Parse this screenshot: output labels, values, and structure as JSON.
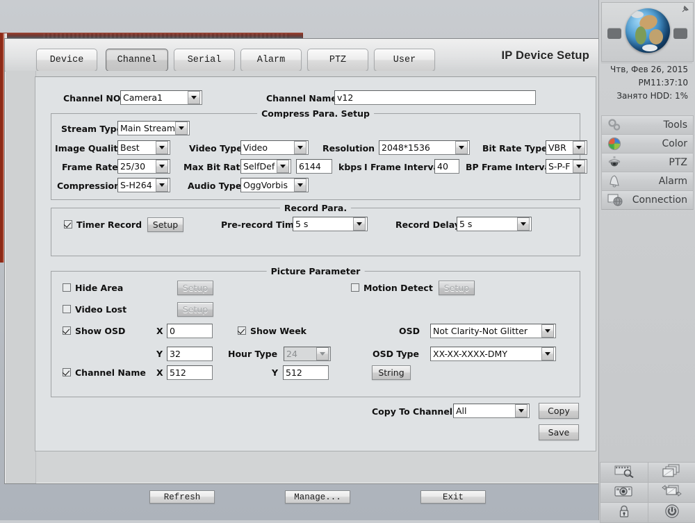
{
  "window": {
    "title": "IP Device Setup"
  },
  "tabs": [
    {
      "label": "Device",
      "active": false
    },
    {
      "label": "Channel",
      "active": true
    },
    {
      "label": "Serial",
      "active": false
    },
    {
      "label": "Alarm",
      "active": false
    },
    {
      "label": "PTZ",
      "active": false
    },
    {
      "label": "User",
      "active": false
    }
  ],
  "top_row": {
    "channel_no_label": "Channel NO",
    "channel_no_value": "Camera1",
    "channel_name_label": "Channel Name",
    "channel_name_value": "v12"
  },
  "compress": {
    "title": "Compress Para. Setup",
    "stream_type_label": "Stream Type",
    "stream_type_value": "Main Stream",
    "image_quality_label": "Image Quality",
    "image_quality_value": "Best",
    "video_type_label": "Video Type",
    "video_type_value": "Video",
    "resolution_label": "Resolution",
    "resolution_value": "2048*1536",
    "bit_rate_type_label": "Bit Rate Type",
    "bit_rate_type_value": "VBR",
    "frame_rate_label": "Frame Rate",
    "frame_rate_value": "25/30",
    "max_bit_rate_label": "Max Bit Rate",
    "max_bit_rate_mode": "SelfDef",
    "max_bit_rate_value": "6144",
    "kbps_label": "kbps",
    "i_frame_interval_label": "I Frame Interval",
    "i_frame_interval_value": "40",
    "bp_frame_interval_label": "BP Frame Interval",
    "bp_frame_interval_value": "S-P-F",
    "compression_label": "Compression",
    "compression_value": "S-H264",
    "audio_type_label": "Audio Type",
    "audio_type_value": "OggVorbis"
  },
  "record": {
    "title": "Record Para.",
    "timer_record_label": "Timer Record",
    "timer_record_checked": true,
    "setup_label": "Setup",
    "prerecord_label": "Pre-record Time",
    "prerecord_value": "5 s",
    "record_delay_label": "Record Delay",
    "record_delay_value": "5 s"
  },
  "picture": {
    "title": "Picture Parameter",
    "hide_area_label": "Hide Area",
    "hide_area_checked": false,
    "hide_area_setup_label": "Setup",
    "motion_detect_label": "Motion Detect",
    "motion_detect_checked": false,
    "motion_detect_setup_label": "Setup",
    "video_lost_label": "Video Lost",
    "video_lost_checked": false,
    "video_lost_setup_label": "Setup",
    "show_osd_label": "Show OSD",
    "show_osd_checked": true,
    "osd_x_label": "X",
    "osd_x_value": "0",
    "osd_y_label": "Y",
    "osd_y_value": "32",
    "show_week_label": "Show Week",
    "show_week_checked": true,
    "hour_type_label": "Hour Type",
    "hour_type_value": "24",
    "osd_label": "OSD",
    "osd_value": "Not Clarity-Not Glitter",
    "osd_type_label": "OSD Type",
    "osd_type_value": "XX-XX-XXXX-DMY",
    "channel_name_label": "Channel Name",
    "channel_name_checked": true,
    "cn_x_label": "X",
    "cn_x_value": "512",
    "cn_y_label": "Y",
    "cn_y_value": "512",
    "string_label": "String"
  },
  "copy": {
    "copy_to_channel_label": "Copy To Channel",
    "copy_to_channel_value": "All",
    "copy_label": "Copy",
    "save_label": "Save"
  },
  "footer": {
    "refresh_label": "Refresh",
    "manage_label": "Manage...",
    "exit_label": "Exit"
  },
  "sidebar": {
    "date": "Чтв, Фев 26, 2015",
    "time": "PM11:37:10",
    "hdd": "Занято HDD: 1%",
    "items": [
      {
        "label": "Tools",
        "icon": "gears-icon"
      },
      {
        "label": "Color",
        "icon": "color-wheel-icon"
      },
      {
        "label": "PTZ",
        "icon": "dome-camera-icon"
      },
      {
        "label": "Alarm",
        "icon": "bell-icon"
      },
      {
        "label": "Connection",
        "icon": "monitor-globe-icon"
      }
    ],
    "grid": [
      {
        "icon": "playback-search-icon"
      },
      {
        "icon": "multi-window-icon"
      },
      {
        "icon": "snapshot-camera-icon"
      },
      {
        "icon": "sequence-icon"
      },
      {
        "icon": "lock-icon"
      },
      {
        "icon": "power-icon"
      }
    ]
  },
  "colors": {
    "dialog_bg": "#d2d4d5",
    "panel_bg": "#dfe2e4",
    "accent_red": "#8d2a17",
    "sidebar_bg": "#cfd1d3"
  }
}
